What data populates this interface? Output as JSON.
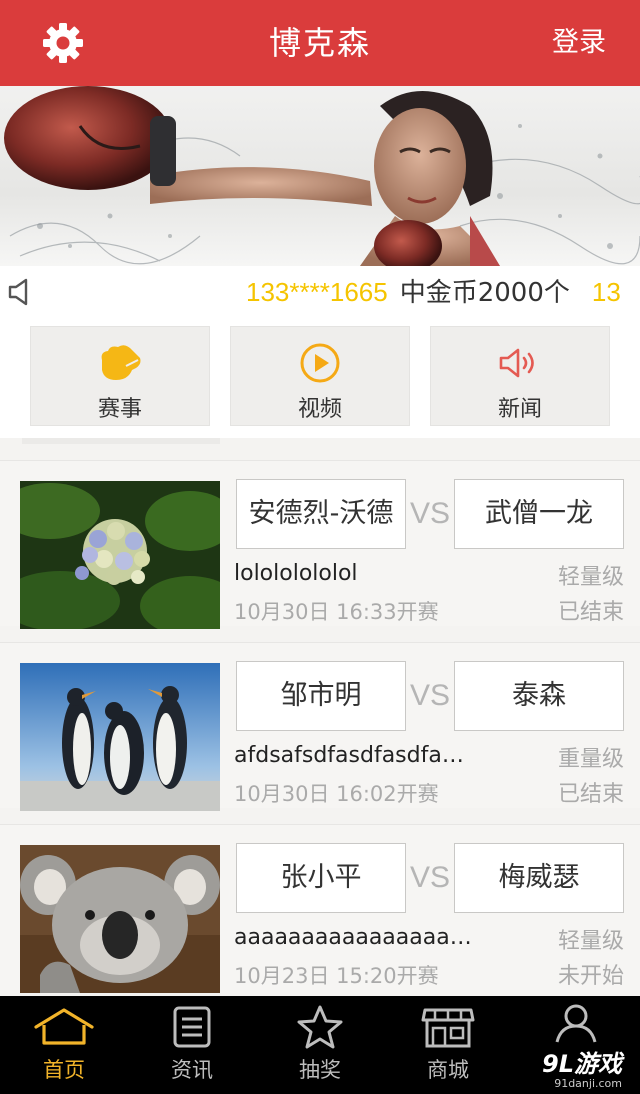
{
  "header": {
    "title": "博克森",
    "login_label": "登录"
  },
  "ticker": {
    "phone": "133****1665",
    "message": "中金币2000个",
    "phone_next": "13"
  },
  "categories": [
    {
      "label": "赛事",
      "icon": "glove-icon"
    },
    {
      "label": "视频",
      "icon": "play-icon"
    },
    {
      "label": "新闻",
      "icon": "speaker-icon"
    }
  ],
  "matches": [
    {
      "player1": "安德烈-沃德",
      "vs": "VS",
      "player2": "武僧一龙",
      "name": "lolololololol",
      "weight": "轻量级",
      "time": "10月30日 16:33开赛",
      "status": "已结束",
      "thumb": "hydrangea-photo"
    },
    {
      "player1": "邹市明",
      "vs": "VS",
      "player2": "泰森",
      "name": "afdsafsdfasdfasdfa…",
      "weight": "重量级",
      "time": "10月30日 16:02开赛",
      "status": "已结束",
      "thumb": "penguins-photo"
    },
    {
      "player1": "张小平",
      "vs": "VS",
      "player2": "梅威瑟",
      "name": "aaaaaaaaaaaaaaaaa…",
      "weight": "轻量级",
      "time": "10月23日 15:20开赛",
      "status": "未开始",
      "thumb": "koala-photo"
    }
  ],
  "tabs": [
    {
      "label": "首页",
      "icon": "home-icon",
      "active": true
    },
    {
      "label": "资讯",
      "icon": "news-doc-icon"
    },
    {
      "label": "抽奖",
      "icon": "star-icon"
    },
    {
      "label": "商城",
      "icon": "store-icon"
    },
    {
      "label": "",
      "icon": "user-icon"
    }
  ],
  "watermark": {
    "brand": "9L游戏",
    "site": "91danji.com"
  },
  "colors": {
    "header": "#da3c3c",
    "accent": "#f5c400",
    "tab_active": "#f2b42a",
    "tab_bg": "#000000"
  }
}
